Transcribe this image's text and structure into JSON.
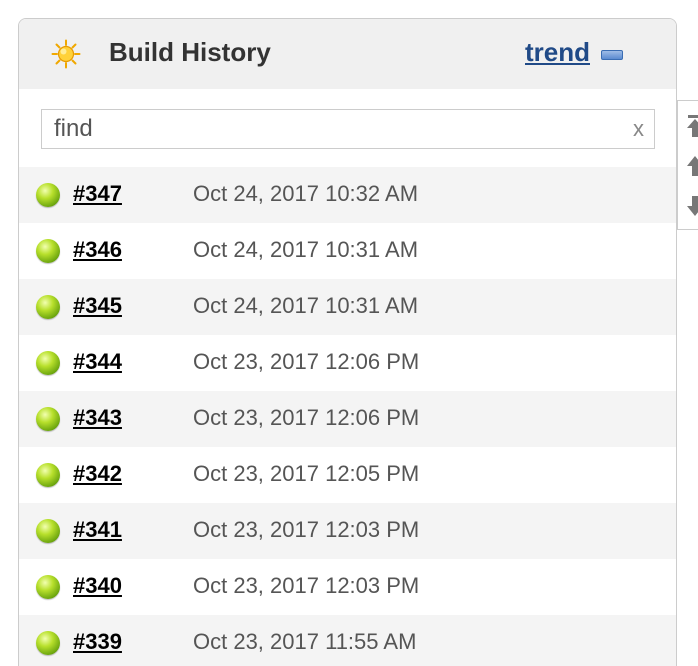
{
  "widget": {
    "title": "Build History",
    "trend_label": "trend",
    "icons": {
      "weather": "sun-icon",
      "collapse": "minus-icon"
    }
  },
  "search": {
    "placeholder": "find",
    "value": "",
    "clear_label": "x"
  },
  "builds": [
    {
      "number": "#347",
      "date": "Oct 24, 2017 10:32 AM",
      "status": "success"
    },
    {
      "number": "#346",
      "date": "Oct 24, 2017 10:31 AM",
      "status": "success"
    },
    {
      "number": "#345",
      "date": "Oct 24, 2017 10:31 AM",
      "status": "success"
    },
    {
      "number": "#344",
      "date": "Oct 23, 2017 12:06 PM",
      "status": "success"
    },
    {
      "number": "#343",
      "date": "Oct 23, 2017 12:06 PM",
      "status": "success"
    },
    {
      "number": "#342",
      "date": "Oct 23, 2017 12:05 PM",
      "status": "success"
    },
    {
      "number": "#341",
      "date": "Oct 23, 2017 12:03 PM",
      "status": "success"
    },
    {
      "number": "#340",
      "date": "Oct 23, 2017 12:03 PM",
      "status": "success"
    },
    {
      "number": "#339",
      "date": "Oct 23, 2017 11:55 AM",
      "status": "success"
    }
  ],
  "colors": {
    "success": "#7fbf10",
    "link": "#204a87",
    "header_bg": "#f0f0f0",
    "row_alt_bg": "#f4f4f4"
  },
  "pagination": {
    "icons": [
      "first-page-icon",
      "page-up-icon",
      "page-down-icon"
    ]
  }
}
